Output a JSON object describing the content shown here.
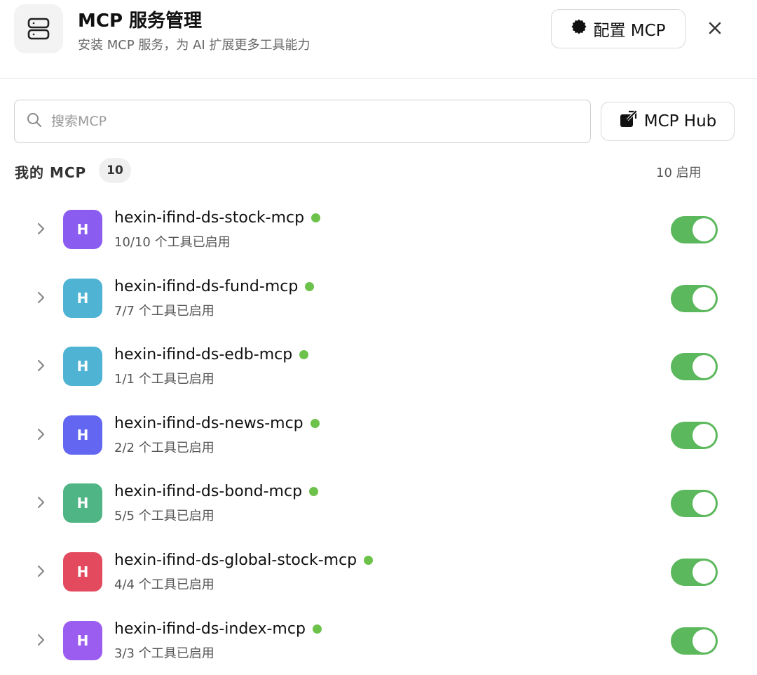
{
  "header": {
    "title": "MCP 服务管理",
    "subtitle": "安装 MCP 服务，为 AI 扩展更多工具能力",
    "icon": "server-icon",
    "config_label": "配置 MCP",
    "config_icon": "gear-icon",
    "close_icon": "close-icon"
  },
  "search": {
    "placeholder": "搜索MCP",
    "value": "",
    "icon": "search-icon"
  },
  "hub": {
    "label": "MCP Hub",
    "icon": "external-link-icon"
  },
  "section": {
    "title": "我的 MCP",
    "count": "10",
    "enabled_text": "10 启用"
  },
  "colors": {
    "status_dot": "#6cc24a",
    "toggle_on": "#5cb85c"
  },
  "mcps": [
    {
      "initial": "H",
      "name": "hexin-ifind-ds-stock-mcp",
      "tools": "10/10 个工具已启用",
      "color": "#8a5cf0",
      "enabled": true
    },
    {
      "initial": "H",
      "name": "hexin-ifind-ds-fund-mcp",
      "tools": "7/7 个工具已启用",
      "color": "#4fb3d3",
      "enabled": true
    },
    {
      "initial": "H",
      "name": "hexin-ifind-ds-edb-mcp",
      "tools": "1/1 个工具已启用",
      "color": "#4fb3d3",
      "enabled": true
    },
    {
      "initial": "H",
      "name": "hexin-ifind-ds-news-mcp",
      "tools": "2/2 个工具已启用",
      "color": "#6366f1",
      "enabled": true
    },
    {
      "initial": "H",
      "name": "hexin-ifind-ds-bond-mcp",
      "tools": "5/5 个工具已启用",
      "color": "#4fb585",
      "enabled": true
    },
    {
      "initial": "H",
      "name": "hexin-ifind-ds-global-stock-mcp",
      "tools": "4/4 个工具已启用",
      "color": "#e34a5e",
      "enabled": true
    },
    {
      "initial": "H",
      "name": "hexin-ifind-ds-index-mcp",
      "tools": "3/3 个工具已启用",
      "color": "#9b5cf0",
      "enabled": true
    }
  ]
}
